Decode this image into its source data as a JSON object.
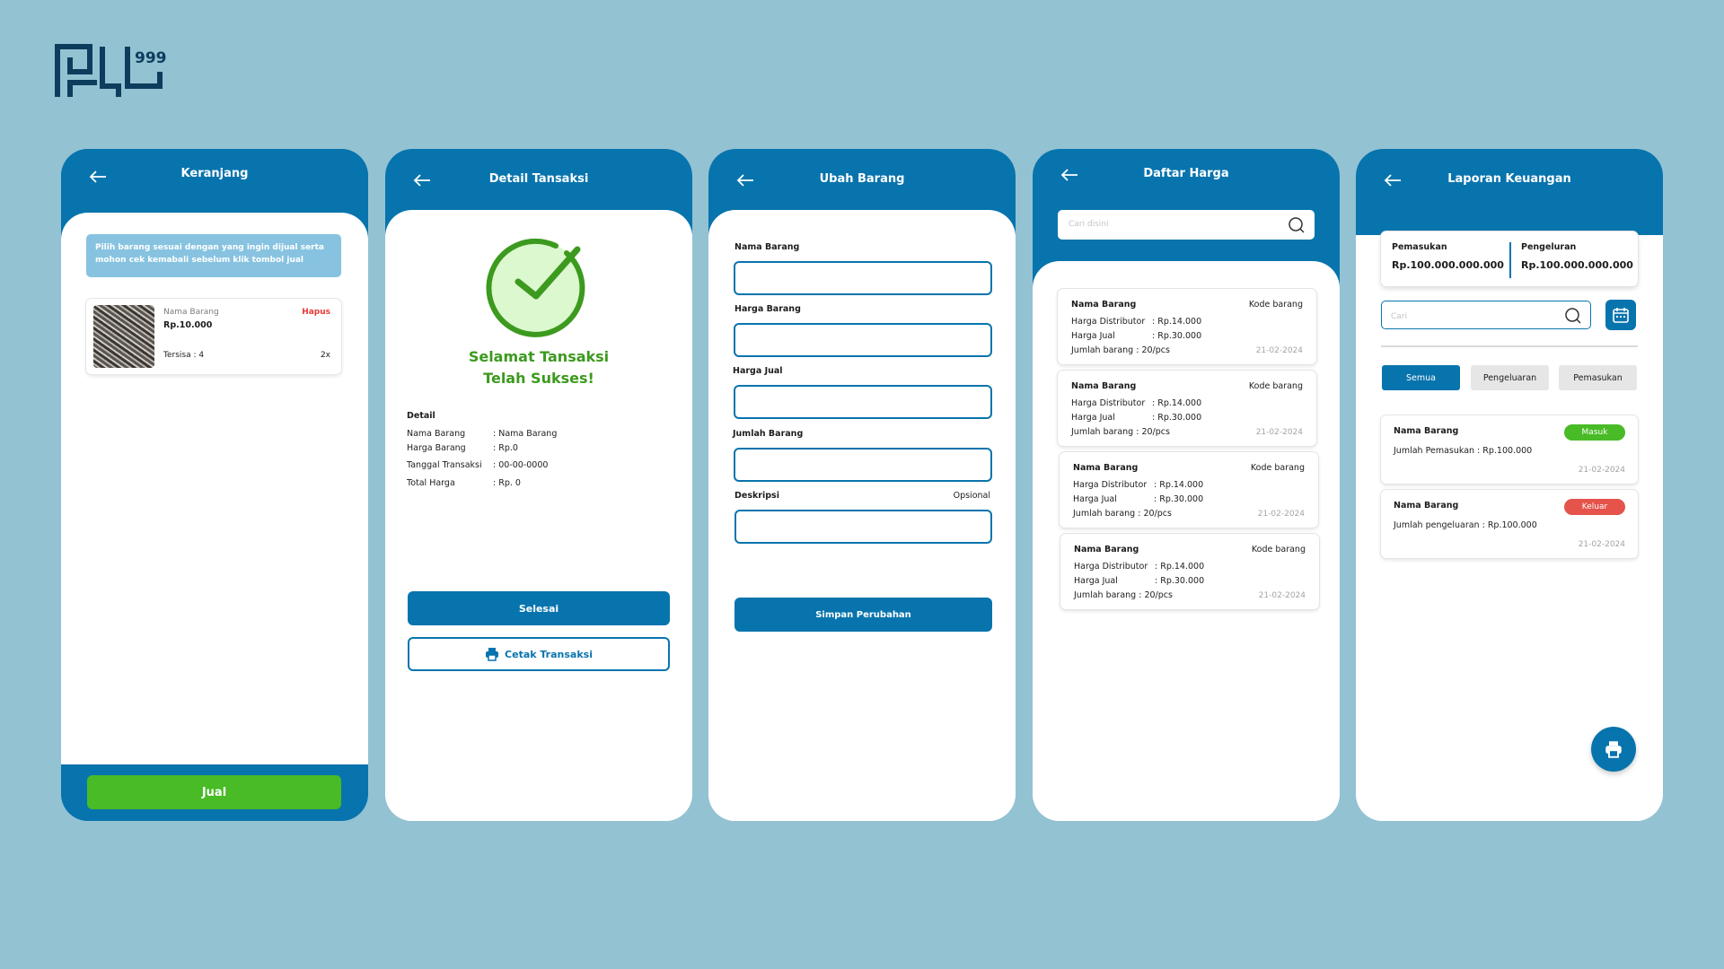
{
  "brand": {
    "logo_text": "PJL",
    "logo_sup": "999"
  },
  "colors": {
    "primary": "#0874ad",
    "success": "#48bb26",
    "danger": "#e53935",
    "background": "#93c2d3"
  },
  "keranjang": {
    "title": "Keranjang",
    "info": "Pilih barang sesuai dengan yang ingin dijual serta mohon cek kemabali sebelum klik tombol jual",
    "item": {
      "name": "Nama Barang",
      "price": "Rp.10.000",
      "delete": "Hapus",
      "stock": "Tersisa  : 4",
      "qty": "2x"
    },
    "jual_button": "Jual"
  },
  "detail": {
    "title": "Detail Tansaksi",
    "success_line1": "Selamat Tansaksi",
    "success_line2": "Telah Sukses!",
    "section": "Detail",
    "rows": [
      {
        "key": "Nama Barang",
        "value": ": Nama Barang"
      },
      {
        "key": "Harga Barang",
        "value": ": Rp.0"
      },
      {
        "key": "Tanggal Transaksi",
        "value": ": 00-00-0000"
      },
      {
        "key": "Total Harga",
        "value": ": Rp. 0"
      }
    ],
    "selesai_button": "Selesai",
    "cetak_button": "Cetak Transaksi"
  },
  "ubah": {
    "title": "Ubah Barang",
    "fields": [
      "Nama  Barang",
      "Harga Barang",
      "Harga Jual",
      "Jumlah Barang",
      "Deskripsi"
    ],
    "optional": "Opsional",
    "simpan_button": "Simpan Perubahan"
  },
  "daftar": {
    "title": "Daftar Harga",
    "search_placeholder": "Cari disini",
    "items": [
      {
        "name": "Nama Barang",
        "code": "Kode barang",
        "k1": "Harga Distributor",
        "v1": ": Rp.14.000",
        "k2": "Harga Jual",
        "v2": ": Rp.30.000",
        "qty": "Jumlah barang : 20/pcs",
        "date": "21-02-2024"
      },
      {
        "name": "Nama Barang",
        "code": "Kode barang",
        "k1": "Harga Distributor",
        "v1": ": Rp.14.000",
        "k2": "Harga Jual",
        "v2": ": Rp.30.000",
        "qty": "Jumlah barang : 20/pcs",
        "date": "21-02-2024"
      },
      {
        "name": "Nama Barang",
        "code": "Kode barang",
        "k1": "Harga Distributor",
        "v1": ": Rp.14.000",
        "k2": "Harga Jual",
        "v2": ": Rp.30.000",
        "qty": "Jumlah barang : 20/pcs",
        "date": "21-02-2024"
      },
      {
        "name": "Nama Barang",
        "code": "Kode barang",
        "k1": "Harga Distributor",
        "v1": ": Rp.14.000",
        "k2": "Harga Jual",
        "v2": ": Rp.30.000",
        "qty": "Jumlah barang : 20/pcs",
        "date": "21-02-2024"
      }
    ]
  },
  "laporan": {
    "title": "Laporan Keuangan",
    "pemasukan_label": "Pemasukan",
    "pemasukan_value": "Rp.100.000.000.000",
    "pengeluaran_label": "Pengeluran",
    "pengeluaran_value": "Rp.100.000.000.000",
    "search_placeholder": "Cari",
    "tabs": [
      "Semua",
      "Pengeluaran",
      "Pemasukan"
    ],
    "transactions": [
      {
        "name": "Nama Barang",
        "badge": "Masuk",
        "badge_color": "#48bb26",
        "text": "Jumlah Pemasukan : Rp.100.000",
        "date": "21-02-2024"
      },
      {
        "name": "Nama Barang",
        "badge": "Keluar",
        "badge_color": "#e5534b",
        "text": "Jumlah pengeluaran : Rp.100.000",
        "date": "21-02-2024"
      }
    ]
  }
}
